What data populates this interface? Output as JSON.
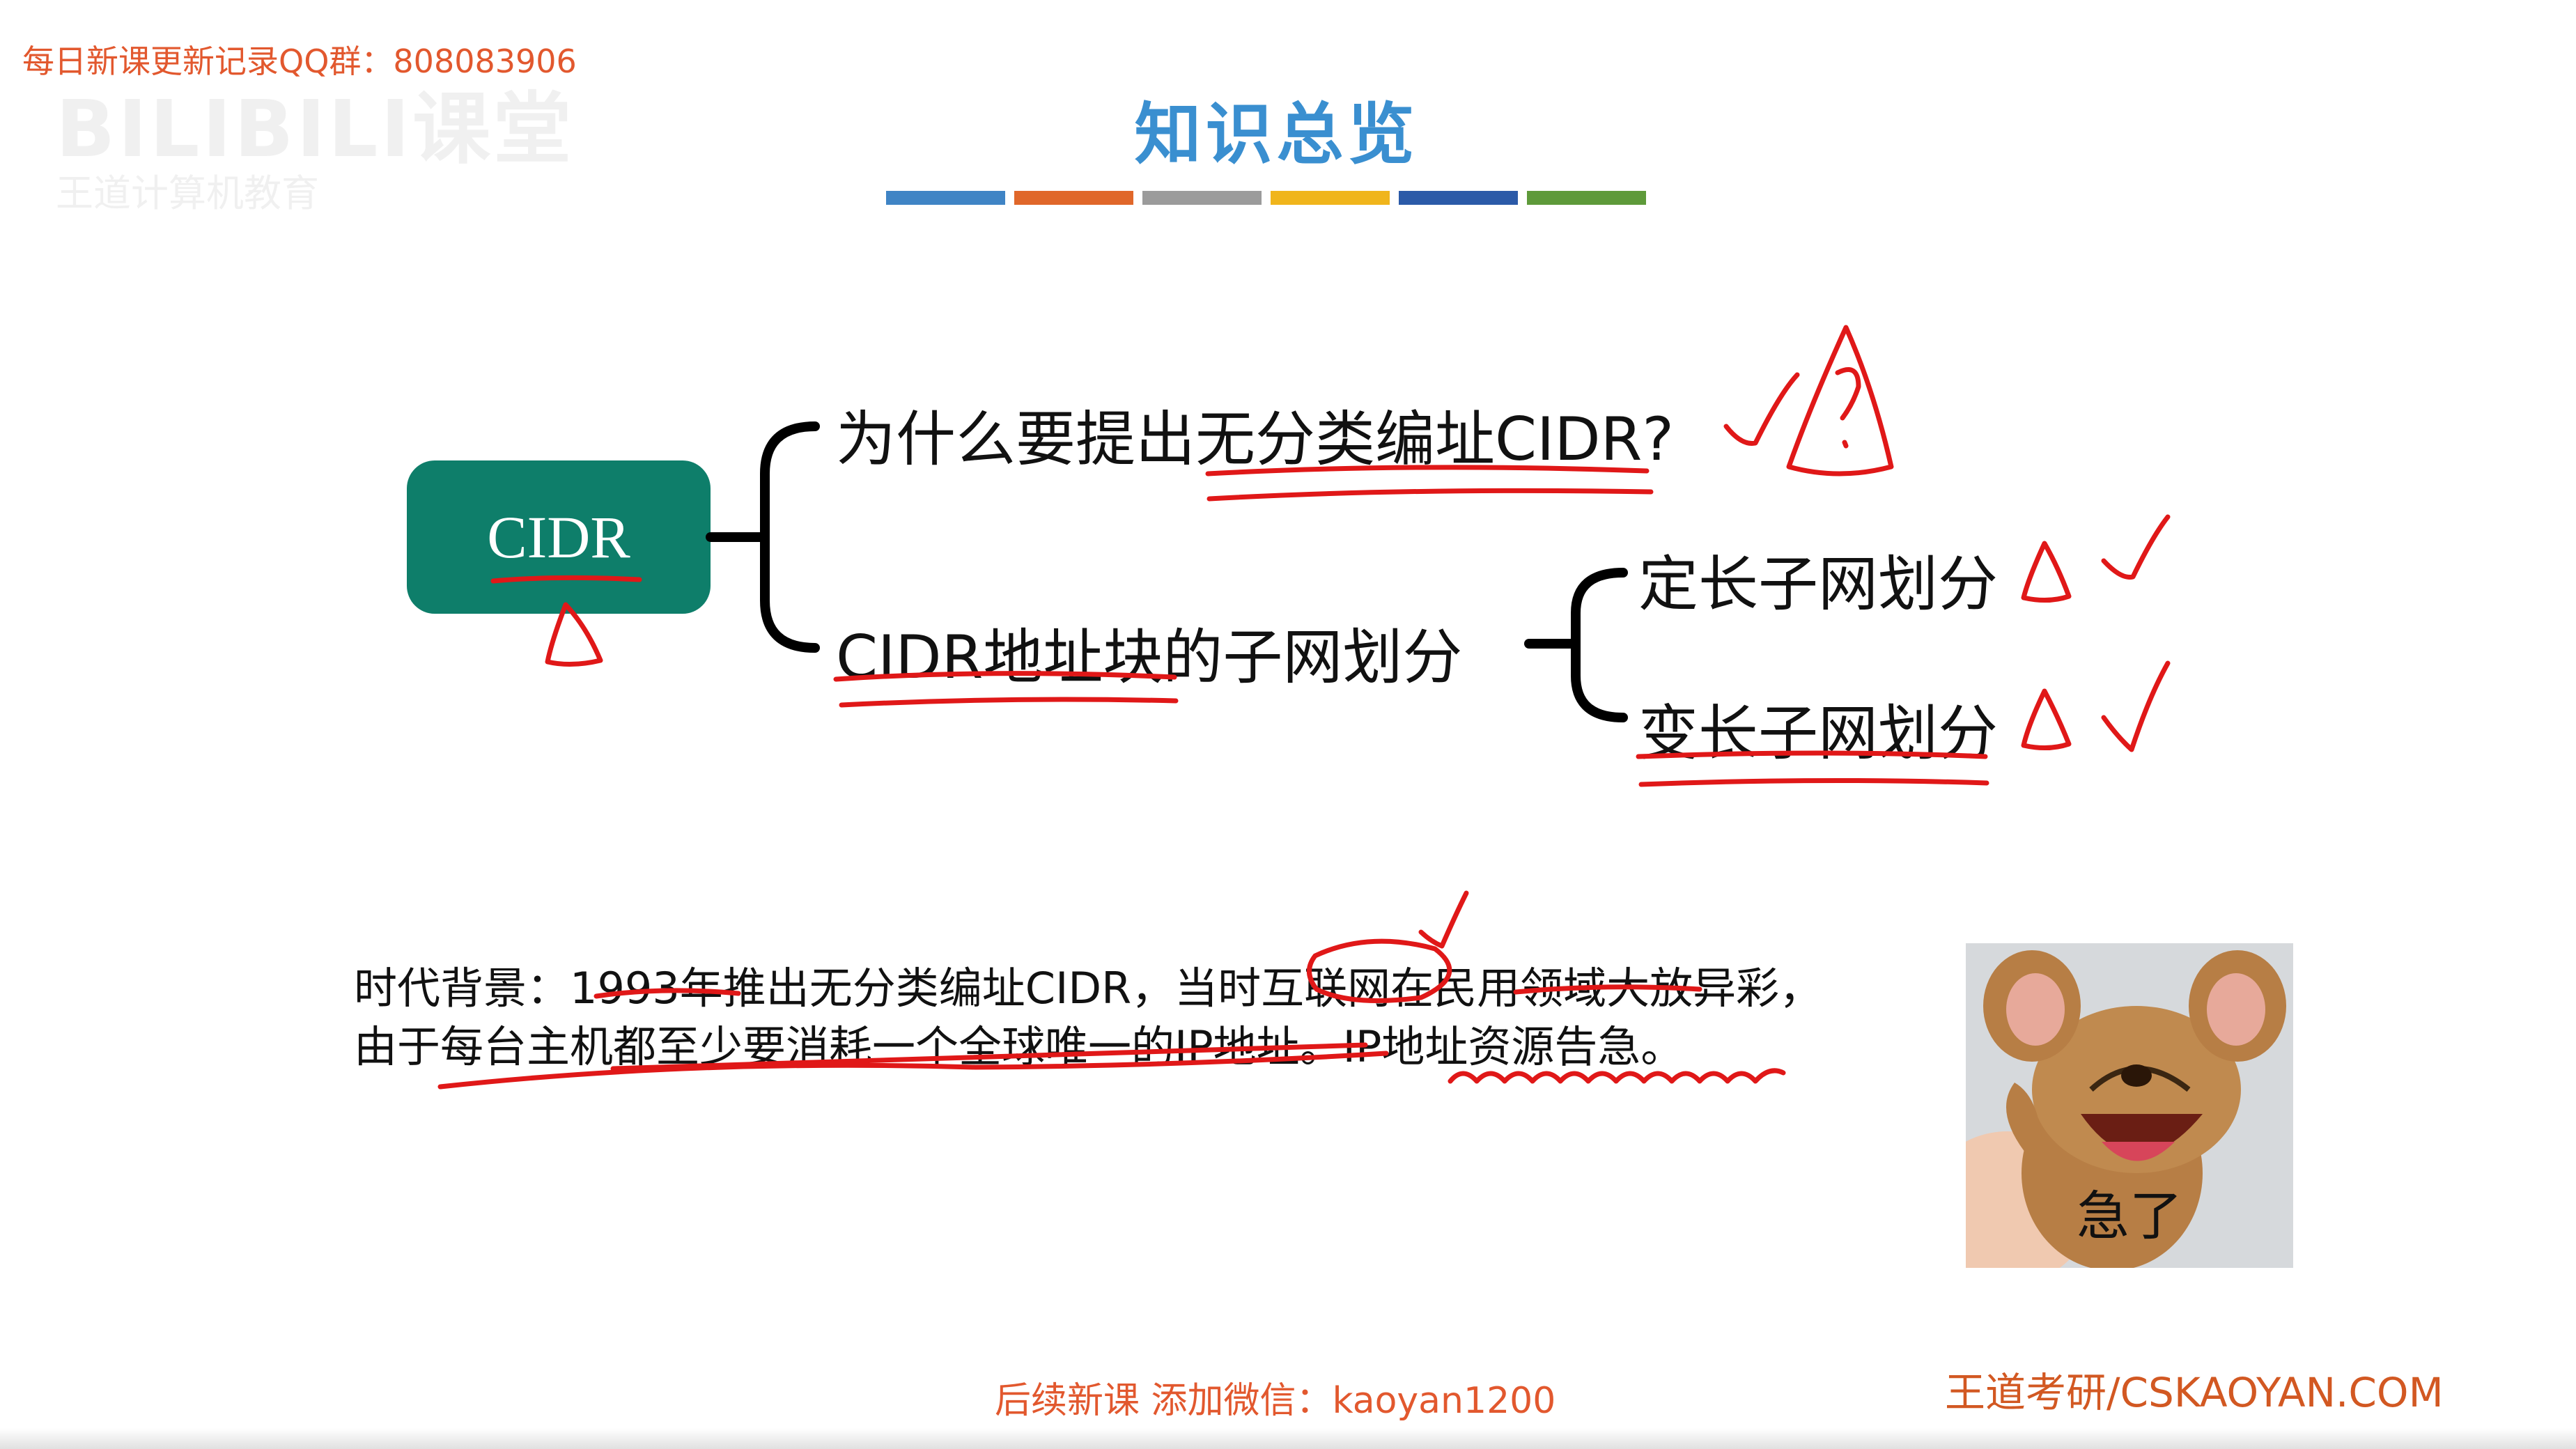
{
  "header": {
    "qq_note": "每日新课更新记录QQ群：808083906",
    "title": "知识总览",
    "color_bar": [
      "#3f84c5",
      "#e0672a",
      "#9b9b9b",
      "#f0b51c",
      "#2b5aa8",
      "#5e9a3a"
    ],
    "watermark": {
      "line1": "BILIBILI课堂",
      "line2": "王道计算机教育"
    }
  },
  "mindmap": {
    "root": "CIDR",
    "branch_why": "为什么要提出无分类编址CIDR?",
    "branch_block": "CIDR地址块的子网划分",
    "sub_fixed": "定长子网划分",
    "sub_variable": "变长子网划分"
  },
  "background_text": {
    "line1": "时代背景：1993年推出无分类编址CIDR，当时互联网在民用领域大放异彩，",
    "line2": "由于每台主机都至少要消耗一个全球唯一的IP地址。IP地址资源告急。"
  },
  "meme": {
    "caption": "急了"
  },
  "footer": {
    "wechat_note": "后续新课 添加微信：kaoyan1200",
    "site": "王道考研/CSKAOYAN.COM"
  },
  "colors": {
    "accent_title": "#3a8fd0",
    "cidr_box": "#0e7e6a",
    "annotation_red": "#e01818",
    "footer_orange": "#e2582e"
  }
}
